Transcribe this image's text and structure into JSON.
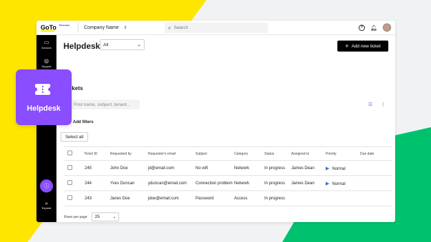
{
  "brand": {
    "logo": "GoTo",
    "product": "Resolve"
  },
  "topbar": {
    "company": "Company Name",
    "search_placeholder": "Search"
  },
  "sidebar": {
    "items": [
      {
        "label": "Devices",
        "icon": "devices-icon"
      },
      {
        "label": "Support",
        "icon": "support-icon"
      }
    ],
    "expand_label": "Expand"
  },
  "page": {
    "title": "Helpdesk",
    "filter_value": "All",
    "add_button": "Add new ticket",
    "section_title": "Tickets",
    "search_placeholder": "Find name, subject, tenant...",
    "add_filters": "Add filters",
    "select_all": "Select all"
  },
  "table": {
    "headers": [
      "Ticket ID",
      "Requested by",
      "Requester's email",
      "Subject",
      "Category",
      "Status",
      "Assigned to",
      "Priority",
      "Due date"
    ],
    "rows": [
      {
        "id": "245",
        "requested_by": "John Doe",
        "email": "jd@email.com",
        "subject": "No wifi",
        "category": "Network",
        "status": "In progress",
        "assigned": "James Dean",
        "priority": "Normal",
        "due": ""
      },
      {
        "id": "244",
        "requested_by": "Yves Duncan",
        "email": "yduncan@email.com",
        "subject": "Connection problem",
        "category": "Network",
        "status": "In progress",
        "assigned": "James Dean",
        "priority": "Normal",
        "due": ""
      },
      {
        "id": "243",
        "requested_by": "Janes Doe",
        "email": "jdoe@email.com",
        "subject": "Password",
        "category": "Access",
        "status": "In progress",
        "assigned": "",
        "priority": "",
        "due": ""
      }
    ]
  },
  "pagination": {
    "rows_per_page_label": "Rows per page",
    "rows_per_page_value": "25"
  },
  "promo": {
    "label": "Helpdesk"
  },
  "colors": {
    "accent": "#8a4dff",
    "yellow": "#ffe600",
    "green": "#00c26e",
    "priority": "#3b73d6"
  }
}
